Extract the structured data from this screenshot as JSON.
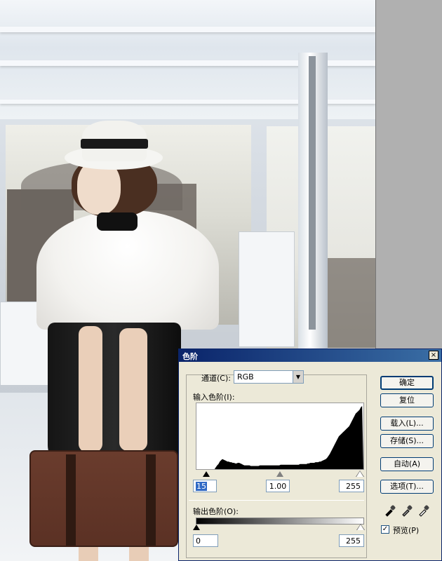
{
  "dialog": {
    "title": "色阶",
    "close_label": "×",
    "channel_label": "通道(C):",
    "channel_value": "RGB",
    "input_levels_label": "输入色阶(I):",
    "input_black": "15",
    "input_gamma": "1.00",
    "input_white": "255",
    "output_levels_label": "输出色阶(O):",
    "output_black": "0",
    "output_white": "255",
    "buttons": {
      "ok": "确定",
      "reset": "复位",
      "load": "载入(L)...",
      "save": "存储(S)...",
      "auto": "自动(A)",
      "options": "选项(T)..."
    },
    "preview_label": "预览(P)",
    "preview_checked": true,
    "histogram": [
      0,
      0,
      0,
      0,
      0,
      0,
      0,
      0,
      0,
      0,
      0,
      0,
      0,
      0,
      0,
      3,
      6,
      8,
      12,
      14,
      16,
      15,
      14,
      13,
      12,
      12,
      11,
      11,
      10,
      10,
      9,
      9,
      10,
      10,
      9,
      8,
      7,
      6,
      6,
      6,
      6,
      6,
      5,
      5,
      5,
      5,
      5,
      5,
      5,
      6,
      6,
      6,
      6,
      6,
      6,
      6,
      6,
      6,
      6,
      6,
      6,
      6,
      6,
      6,
      6,
      7,
      7,
      7,
      7,
      7,
      7,
      7,
      7,
      7,
      7,
      7,
      7,
      7,
      7,
      7,
      8,
      8,
      8,
      8,
      8,
      8,
      9,
      9,
      10,
      10,
      10,
      10,
      11,
      11,
      11,
      12,
      12,
      13,
      14,
      15,
      16,
      18,
      21,
      24,
      28,
      32,
      36,
      40,
      44,
      48,
      52,
      54,
      56,
      58,
      60,
      62,
      64,
      66,
      68,
      72,
      76,
      80,
      84,
      88,
      90,
      92,
      94,
      98,
      100
    ]
  },
  "icons": {
    "dropdown": "chevron-down-icon",
    "eyedropper_black": "eyedropper-black-icon",
    "eyedropper_gray": "eyedropper-gray-icon",
    "eyedropper_white": "eyedropper-white-icon"
  },
  "colors": {
    "title_bar": "#0a246a",
    "dialog_bg": "#ece9d8",
    "selection": "#316ac5"
  }
}
